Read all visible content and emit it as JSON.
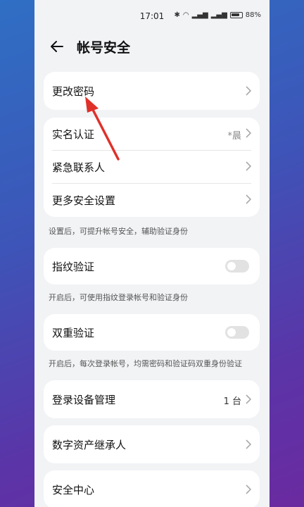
{
  "status": {
    "time": "17:01",
    "battery": "88%"
  },
  "header": {
    "title": "帐号安全"
  },
  "rows": {
    "change_password": "更改密码",
    "real_name": "实名认证",
    "real_name_value": "*晨",
    "emergency": "紧急联系人",
    "more_security": "更多安全设置",
    "fingerprint": "指纹验证",
    "two_step": "双重验证",
    "device_mgmt": "登录设备管理",
    "device_count": "1 台",
    "digital_heir": "数字资产继承人",
    "security_center": "安全中心"
  },
  "hints": {
    "after_settings": "设置后，可提升帐号安全，辅助验证身份",
    "fingerprint": "开启后，可使用指纹登录帐号和验证身份",
    "two_step": "开启后，每次登录帐号，均需密码和验证码双重身份验证"
  },
  "toggles": {
    "fingerprint": false,
    "two_step": false
  },
  "colors": {
    "annotation_arrow": "#e0302a",
    "background_top": "#2f6fc4",
    "background_bottom": "#6b2aa0"
  }
}
